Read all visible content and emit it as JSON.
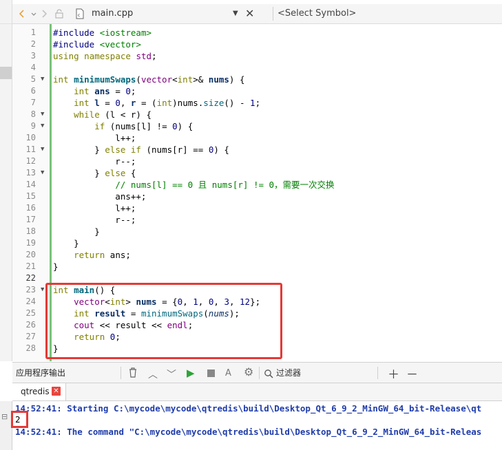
{
  "toolbar": {
    "filename": "main.cpp",
    "symbol_placeholder": "<Select Symbol>"
  },
  "code_lines": [
    {
      "n": "1",
      "html": "<span class=\"pp\">#include</span> <span class=\"str\">&lt;iostream&gt;</span>"
    },
    {
      "n": "2",
      "html": "<span class=\"pp\">#include</span> <span class=\"str\">&lt;vector&gt;</span>"
    },
    {
      "n": "3",
      "html": "<span class=\"kw\">using</span> <span class=\"kw\">namespace</span> <span class=\"ty\">std</span>;"
    },
    {
      "n": "4",
      "html": ""
    },
    {
      "n": "5",
      "fold": true,
      "html": "<span class=\"kw\">int</span> <span class=\"fn\">minimumSwaps</span>(<span class=\"ty\">vector</span>&lt;<span class=\"kw\">int</span>&gt;&amp; <span class=\"var\">nums</span>) {"
    },
    {
      "n": "6",
      "html": "    <span class=\"kw\">int</span> <span class=\"var\">ans</span> = <span class=\"num\">0</span>;"
    },
    {
      "n": "7",
      "html": "    <span class=\"kw\">int</span> <span class=\"var\">l</span> = <span class=\"num\">0</span>, <span class=\"var\">r</span> = (<span class=\"kw\">int</span>)nums.<span class=\"fn\" style=\"font-weight:normal\">size</span>() - <span class=\"num\">1</span>;"
    },
    {
      "n": "8",
      "fold": true,
      "html": "    <span class=\"kw\">while</span> (l &lt; r) {"
    },
    {
      "n": "9",
      "fold": true,
      "html": "        <span class=\"kw\">if</span> (nums[l] != <span class=\"num\">0</span>) {"
    },
    {
      "n": "10",
      "html": "            l++;"
    },
    {
      "n": "11",
      "fold": true,
      "html": "        } <span class=\"kw\">else</span> <span class=\"kw\">if</span> (nums[r] == <span class=\"num\">0</span>) {"
    },
    {
      "n": "12",
      "html": "            r--;"
    },
    {
      "n": "13",
      "fold": true,
      "html": "        } <span class=\"kw\">else</span> {"
    },
    {
      "n": "14",
      "html": "            <span class=\"cm\">// nums[l] == 0 且 nums[r] != 0，需要一次交换</span>"
    },
    {
      "n": "15",
      "html": "            ans++;"
    },
    {
      "n": "16",
      "html": "            l++;"
    },
    {
      "n": "17",
      "html": "            r--;"
    },
    {
      "n": "18",
      "html": "        }"
    },
    {
      "n": "19",
      "html": "    }"
    },
    {
      "n": "20",
      "html": "    <span class=\"kw\">return</span> ans;"
    },
    {
      "n": "21",
      "html": "}"
    },
    {
      "n": "22",
      "cur": true,
      "html": ""
    },
    {
      "n": "23",
      "fold": true,
      "html": "<span class=\"kw\">int</span> <span class=\"fn\">main</span>() {"
    },
    {
      "n": "24",
      "html": "    <span class=\"ty\">vector</span>&lt;<span class=\"kw\">int</span>&gt; <span class=\"var\">nums</span> = {<span class=\"num\">0</span>, <span class=\"num\">1</span>, <span class=\"num\">0</span>, <span class=\"num\">3</span>, <span class=\"num\">12</span>};"
    },
    {
      "n": "25",
      "html": "    <span class=\"kw\">int</span> <span class=\"var\">result</span> = <span class=\"fn\" style=\"font-weight:normal\">minimumSwaps</span>(<span class=\"it\">nums</span>);"
    },
    {
      "n": "26",
      "html": "    <span class=\"dv\">cout</span> &lt;&lt; result &lt;&lt; <span class=\"dv\">endl</span>;"
    },
    {
      "n": "27",
      "html": "    <span class=\"kw\">return</span> <span class=\"num\">0</span>;"
    },
    {
      "n": "28",
      "html": "}"
    }
  ],
  "output_pane": {
    "title": "应用程序输出",
    "filter_placeholder": "过滤器",
    "tab_label": "qtredis",
    "line1": "14:52:41: Starting C:\\mycode\\mycode\\qtredis\\build\\Desktop_Qt_6_9_2_MinGW_64_bit-Release\\qt",
    "result": "2",
    "line2": "14:52:41: The command \"C:\\mycode\\mycode\\qtredis\\build\\Desktop_Qt_6_9_2_MinGW_64_bit-Releas"
  },
  "icons": {
    "nav_back": "back-arrow-icon",
    "nav_forward": "forward-arrow-icon",
    "lock": "lock-icon",
    "file": "cpp-file-icon",
    "clear": "trash-icon",
    "up": "up-arrow-icon",
    "down": "down-arrow-icon",
    "run": "play-icon",
    "stop": "stop-icon",
    "settings": "gear-icon",
    "filter": "search-icon"
  },
  "colors": {
    "highlight_box": "#e53935",
    "output_text": "#1f3cab",
    "run_green": "#2da43a"
  }
}
